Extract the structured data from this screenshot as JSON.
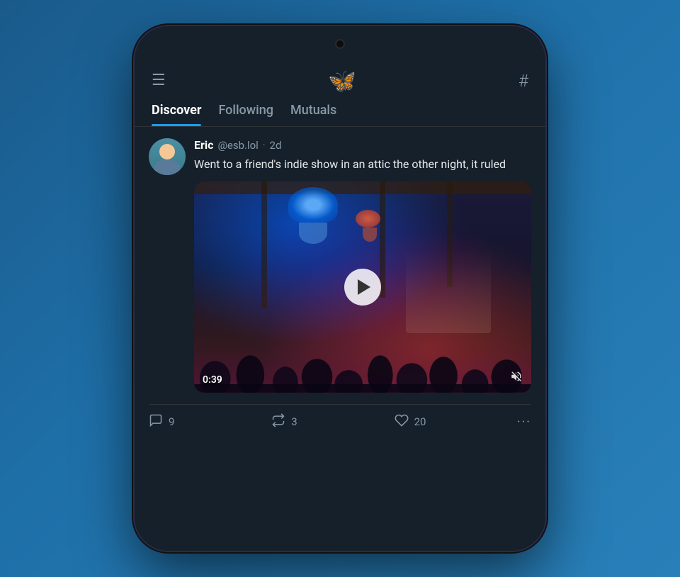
{
  "phone": {
    "header": {
      "menu_label": "☰",
      "logo": "🦋",
      "hashtag_label": "#"
    },
    "tabs": [
      {
        "id": "discover",
        "label": "Discover",
        "active": true
      },
      {
        "id": "following",
        "label": "Following",
        "active": false
      },
      {
        "id": "mutuals",
        "label": "Mutuals",
        "active": false
      }
    ],
    "post": {
      "author_name": "Eric",
      "author_handle": "@esb.lol",
      "dot": "·",
      "time": "2d",
      "text": "Went to a friend's indie show in an attic the other night, it ruled",
      "video": {
        "duration": "0:39"
      },
      "actions": {
        "replies_icon": "💬",
        "replies_count": "9",
        "repost_icon": "🔁",
        "repost_count": "3",
        "like_icon": "♡",
        "like_count": "20",
        "more_icon": "···"
      }
    }
  }
}
